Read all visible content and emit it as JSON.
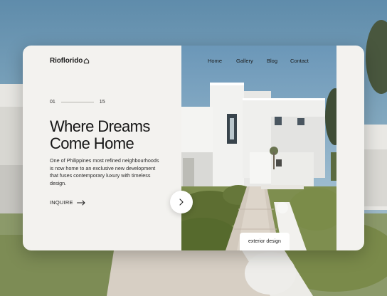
{
  "brand": {
    "name": "Rioflorido",
    "icon": "house-icon"
  },
  "nav": {
    "items": [
      "Home",
      "Gallery",
      "Blog",
      "Contact"
    ],
    "active": "Home"
  },
  "slider": {
    "current": "01",
    "total": "15",
    "next_icon": "chevron-right-icon"
  },
  "hero": {
    "headline_line1": "Where Dreams",
    "headline_line2": "Come Home",
    "description": "One of Philippines most refined neighbourhoods is now home to an exclusive new development that fuses contemporary luxury with timeless design.",
    "cta_label": "INQUIRE",
    "cta_icon": "arrow-right-icon"
  },
  "photo": {
    "tag": "exterior design"
  },
  "colors": {
    "panel": "#f3f2ef",
    "text": "#151515",
    "sky": "#6f98b4"
  }
}
